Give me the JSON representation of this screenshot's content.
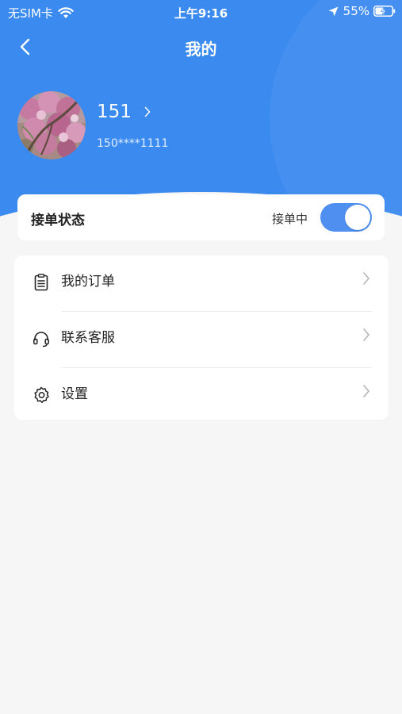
{
  "status_bar": {
    "carrier": "无SIM卡",
    "time": "上午9:16",
    "battery_percent": "55%"
  },
  "nav": {
    "title": "我的",
    "back_icon": "chevron-left-icon"
  },
  "profile": {
    "name": "151",
    "phone": "150****1111",
    "avatar_icon": "blossom-photo"
  },
  "order_status": {
    "label": "接单状态",
    "value": "接单中",
    "enabled": true
  },
  "menu": {
    "items": [
      {
        "label": "我的订单",
        "icon": "clipboard-icon"
      },
      {
        "label": "联系客服",
        "icon": "headset-icon"
      },
      {
        "label": "设置",
        "icon": "gear-icon"
      }
    ]
  },
  "colors": {
    "primary": "#3a8af0",
    "toggle_on": "#4f8ff0",
    "background": "#f6f6f6"
  }
}
